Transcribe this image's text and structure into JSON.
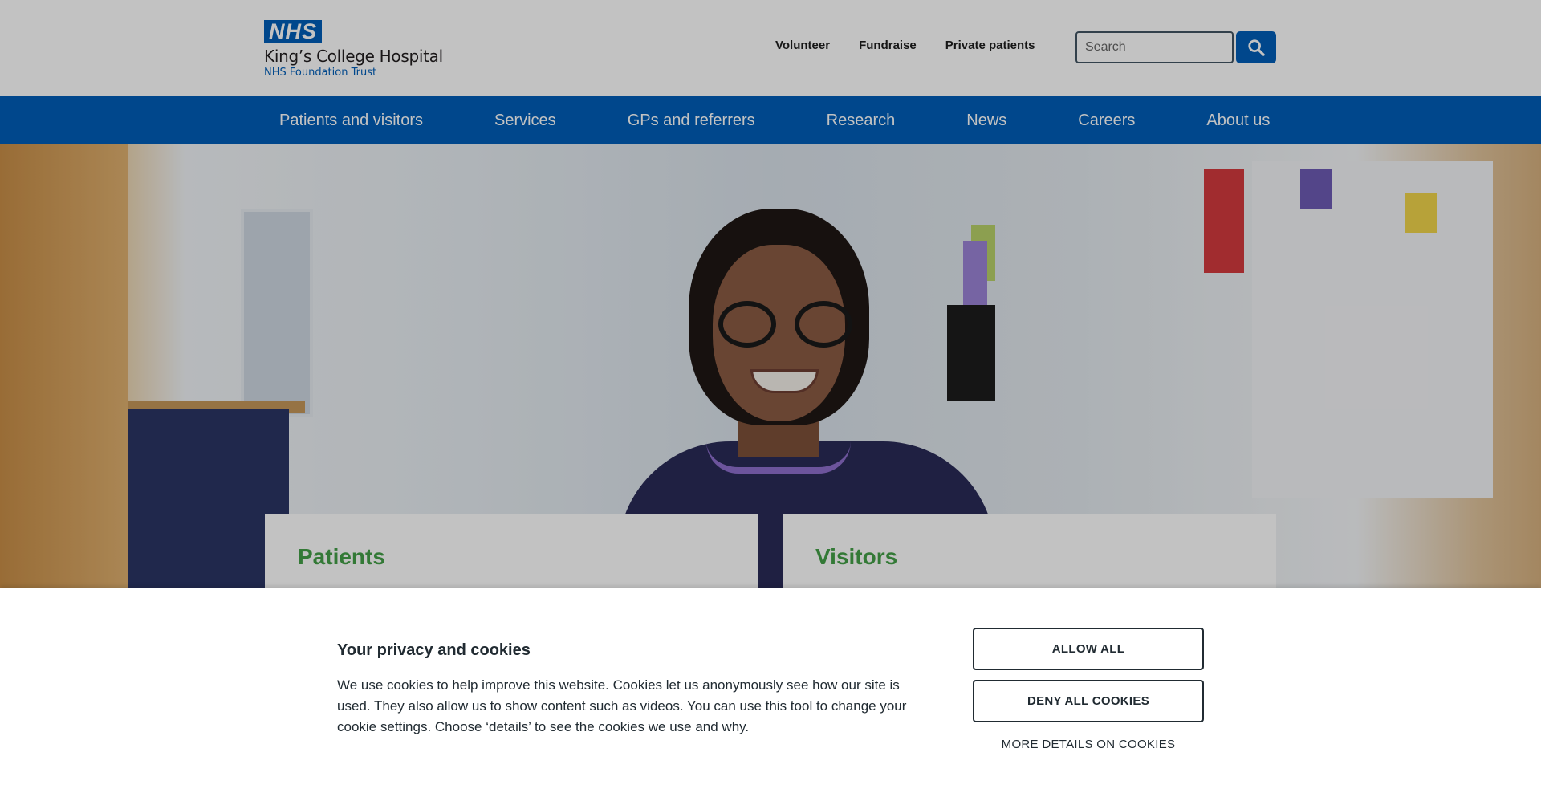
{
  "logo": {
    "nhs": "NHS",
    "name": "King’s College Hospital",
    "trust": "NHS Foundation Trust"
  },
  "utility_nav": {
    "volunteer": "Volunteer",
    "fundraise": "Fundraise",
    "private_patients": "Private patients"
  },
  "search": {
    "placeholder": "Search"
  },
  "main_nav": {
    "items": [
      "Patients and visitors",
      "Services",
      "GPs and referrers",
      "Research",
      "News",
      "Careers",
      "About us"
    ]
  },
  "cards": {
    "patients": "Patients",
    "visitors": "Visitors"
  },
  "cookie_banner": {
    "title": "Your privacy and cookies",
    "text": "We use cookies to help improve this website. Cookies let us anonymously see how our site is used. They also allow us to show content such as videos. You can use this tool to change your cookie settings. Choose ‘details’ to see the cookies we use and why.",
    "allow_label": "ALLOW ALL",
    "deny_label": "DENY ALL COOKIES",
    "more_label": "MORE DETAILS ON COOKIES"
  },
  "colors": {
    "brand_blue": "#005eb8",
    "card_heading_green": "#43a047",
    "text_dark": "#212b32"
  },
  "icons": {
    "search": "search-icon"
  }
}
